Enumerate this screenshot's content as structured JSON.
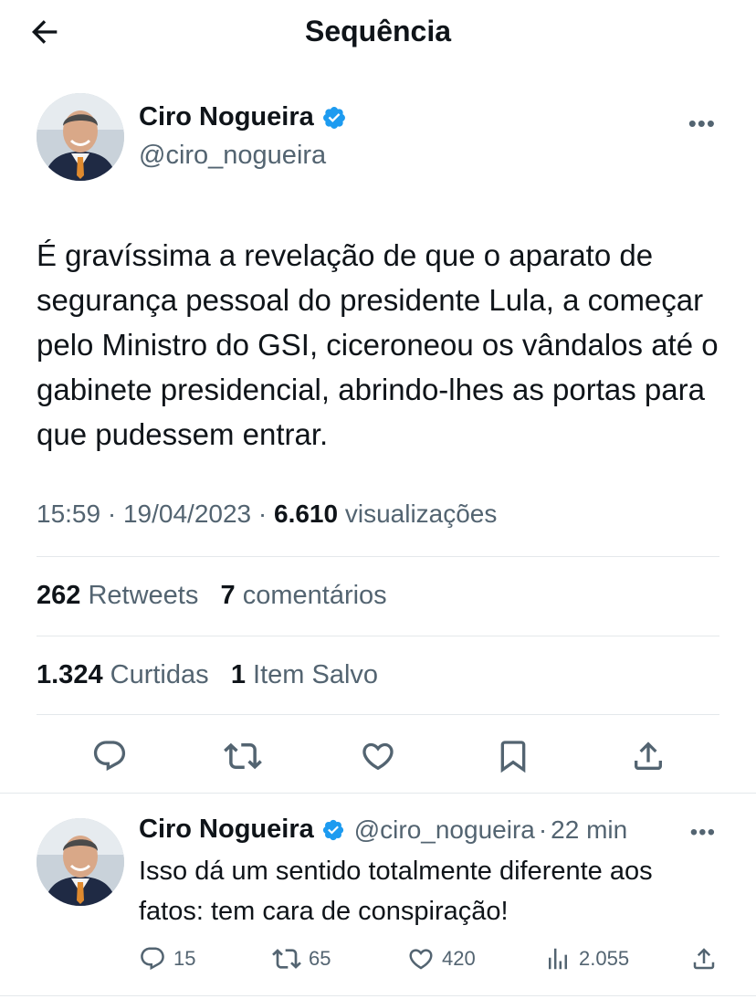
{
  "header": {
    "title": "Sequência"
  },
  "tweet": {
    "author_name": "Ciro Nogueira",
    "author_handle": "@ciro_nogueira",
    "text": "É gravíssima a revelação de que o aparato de segurança pessoal do presidente Lula, a começar pelo Ministro do GSI, ciceroneou os vândalos até o gabinete presidencial, abrindo-lhes as portas para que pudessem entrar.",
    "time": "15:59",
    "date": "19/04/2023",
    "views_count": "6.610",
    "views_label": "visualizações",
    "retweets_count": "262",
    "retweets_label": "Retweets",
    "comments_count": "7",
    "comments_label": "comentários",
    "likes_count": "1.324",
    "likes_label": "Curtidas",
    "saved_count": "1",
    "saved_label": "Item Salvo"
  },
  "reply": {
    "author_name": "Ciro Nogueira",
    "author_handle": "@ciro_nogueira",
    "time": "22 min",
    "text": "Isso dá um sentido totalmente diferente aos fatos: tem cara de conspiração!",
    "replies": "15",
    "retweets": "65",
    "likes": "420",
    "views": "2.055"
  },
  "colors": {
    "accent": "#1d9bf0",
    "secondary_text": "#536471",
    "divider": "#e4e8eb"
  },
  "icons": [
    "back-arrow-icon",
    "verified-badge-icon",
    "more-icon",
    "reply-icon",
    "retweet-icon",
    "like-icon",
    "bookmark-icon",
    "share-icon",
    "views-icon"
  ]
}
